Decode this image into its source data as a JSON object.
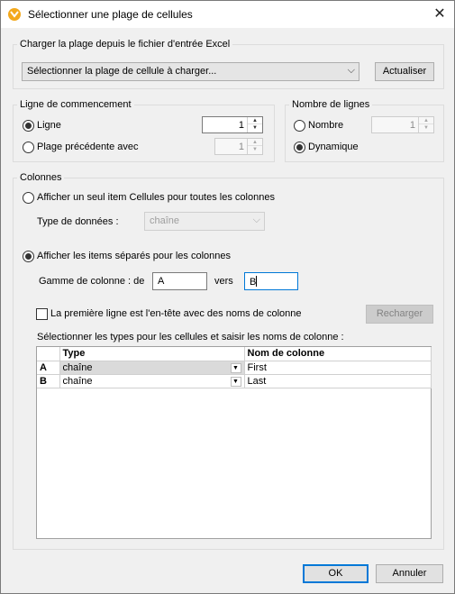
{
  "window": {
    "title": "Sélectionner une plage de cellules",
    "close_glyph": "✕"
  },
  "load": {
    "legend": "Charger la plage depuis le fichier d'entrée Excel",
    "combo_value": "Sélectionner la plage de cellule à charger...",
    "refresh_label": "Actualiser"
  },
  "start_row": {
    "legend": "Ligne de commencement",
    "line_label": "Ligne",
    "line_value": "1",
    "prev_range_label": "Plage précédente avec",
    "prev_range_value": "1"
  },
  "row_count": {
    "legend": "Nombre de lignes",
    "number_label": "Nombre",
    "number_value": "1",
    "dynamic_label": "Dynamique"
  },
  "columns": {
    "legend": "Colonnes",
    "single_item_label": "Afficher un seul item Cellules pour toutes les colonnes",
    "data_type_label": "Type de données :",
    "data_type_value": "chaîne",
    "separate_items_label": "Afficher les items séparés pour les colonnes",
    "range_label": "Gamme de colonne : de",
    "range_from": "A",
    "range_to_label": "vers",
    "range_to": "B",
    "header_row_label": "La première ligne est l'en-tête avec des noms de colonne",
    "reload_label": "Recharger",
    "table_caption": "Sélectionner les types pour les cellules et saisir les noms de colonne :",
    "table": {
      "headers": [
        "",
        "Type",
        "Nom de colonne"
      ],
      "rows": [
        {
          "key": "A",
          "type": "chaîne",
          "name": "First"
        },
        {
          "key": "B",
          "type": "chaîne",
          "name": "Last"
        }
      ]
    }
  },
  "footer": {
    "ok_label": "OK",
    "cancel_label": "Annuler"
  }
}
